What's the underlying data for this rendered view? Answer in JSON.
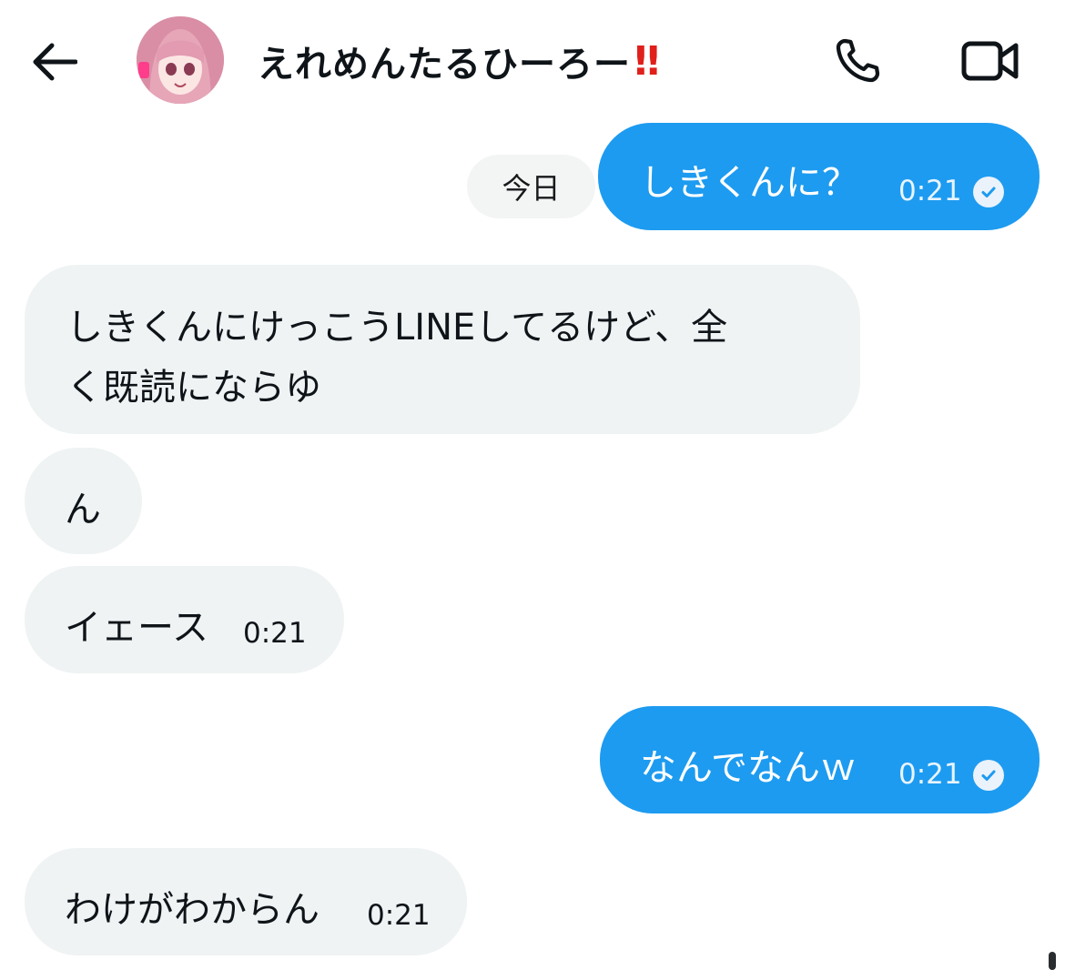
{
  "header": {
    "back_icon": "arrow-left-icon",
    "contact_name": "えれめんたるひーろー",
    "contact_emoji": "‼",
    "phone_icon": "phone-icon",
    "video_icon": "video-camera-icon"
  },
  "date_chip": "今日",
  "messages": [
    {
      "direction": "sent",
      "text": "しきくんに？",
      "time": "0:21",
      "read_icon": "check-circle-icon"
    },
    {
      "direction": "received",
      "text_line1": "しきくんにけっこうLINEしてるけど、全",
      "text_line2": "く既読にならゆ"
    },
    {
      "direction": "received",
      "text": "ん"
    },
    {
      "direction": "received",
      "text": "イェース",
      "time": "0:21"
    },
    {
      "direction": "sent",
      "text": "なんでなんｗ",
      "time": "0:21",
      "read_icon": "check-circle-icon"
    },
    {
      "direction": "received",
      "text": "わけがわからん",
      "time": "0:21"
    }
  ],
  "colors": {
    "sent_bubble": "#1d9bf0",
    "received_bubble": "#eff3f4",
    "date_chip": "#f3f4f4",
    "emoji_red": "#e0201b"
  }
}
